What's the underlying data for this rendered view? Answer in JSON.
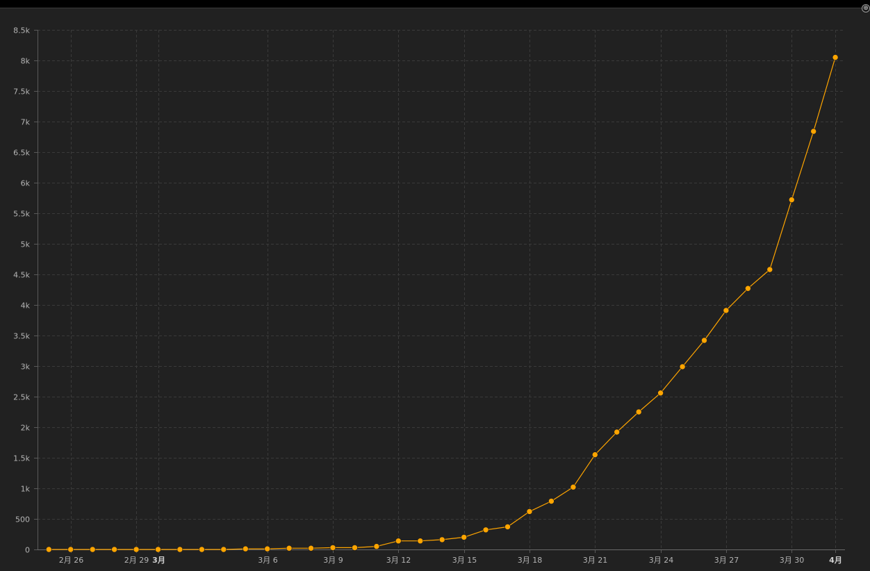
{
  "chart_data": {
    "type": "line",
    "title": "",
    "xlabel": "",
    "ylabel": "",
    "ylim": [
      0,
      8500
    ],
    "y_ticks": [
      0,
      500,
      1000,
      1500,
      2000,
      2500,
      3000,
      3500,
      4000,
      4500,
      5000,
      5500,
      6000,
      6500,
      7000,
      7500,
      8000,
      8500
    ],
    "y_tick_labels": [
      "0",
      "500",
      "1k",
      "1.5k",
      "2k",
      "2.5k",
      "3k",
      "3.5k",
      "4k",
      "4.5k",
      "5k",
      "5.5k",
      "6k",
      "6.5k",
      "7k",
      "7.5k",
      "8k",
      "8.5k"
    ],
    "x_tick_labels": [
      {
        "label": "2月 26",
        "date": "2020-02-26",
        "bold": false
      },
      {
        "label": "2月 29",
        "date": "2020-02-29",
        "bold": false
      },
      {
        "label": "3月",
        "date": "2020-03-01",
        "bold": true
      },
      {
        "label": "3月 6",
        "date": "2020-03-06",
        "bold": false
      },
      {
        "label": "3月 9",
        "date": "2020-03-09",
        "bold": false
      },
      {
        "label": "3月 12",
        "date": "2020-03-12",
        "bold": false
      },
      {
        "label": "3月 15",
        "date": "2020-03-15",
        "bold": false
      },
      {
        "label": "3月 18",
        "date": "2020-03-18",
        "bold": false
      },
      {
        "label": "3月 21",
        "date": "2020-03-21",
        "bold": false
      },
      {
        "label": "3月 24",
        "date": "2020-03-24",
        "bold": false
      },
      {
        "label": "3月 27",
        "date": "2020-03-27",
        "bold": false
      },
      {
        "label": "3月 30",
        "date": "2020-03-30",
        "bold": false
      },
      {
        "label": "4月",
        "date": "2020-04-01",
        "bold": true
      }
    ],
    "grid": true,
    "series": [
      {
        "color": "#ffa500",
        "x": [
          "2020-02-25",
          "2020-02-26",
          "2020-02-27",
          "2020-02-28",
          "2020-02-29",
          "2020-03-01",
          "2020-03-02",
          "2020-03-03",
          "2020-03-04",
          "2020-03-05",
          "2020-03-06",
          "2020-03-07",
          "2020-03-08",
          "2020-03-09",
          "2020-03-10",
          "2020-03-11",
          "2020-03-12",
          "2020-03-13",
          "2020-03-14",
          "2020-03-15",
          "2020-03-16",
          "2020-03-17",
          "2020-03-18",
          "2020-03-19",
          "2020-03-20",
          "2020-03-21",
          "2020-03-22",
          "2020-03-23",
          "2020-03-24",
          "2020-03-25",
          "2020-03-26",
          "2020-03-27",
          "2020-03-28",
          "2020-03-29",
          "2020-03-30",
          "2020-03-31",
          "2020-04-01"
        ],
        "y": [
          0,
          0,
          0,
          0,
          0,
          0,
          0,
          0,
          0,
          10,
          10,
          20,
          20,
          30,
          30,
          50,
          140,
          140,
          160,
          200,
          320,
          370,
          620,
          790,
          1020,
          1550,
          1920,
          2250,
          2560,
          2990,
          3420,
          3910,
          4270,
          4580,
          5720,
          6840,
          8050
        ]
      }
    ]
  },
  "controls": {
    "corner_handle_icon": "expand-icon"
  },
  "colors": {
    "background": "#212121",
    "grid": "#3a3a3a",
    "line": "#ffa500"
  }
}
